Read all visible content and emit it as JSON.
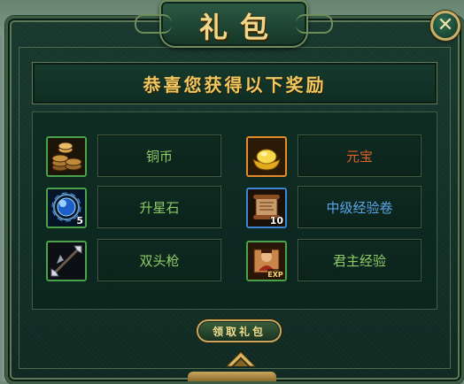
{
  "dialog": {
    "title": "礼包",
    "close_label": "✕",
    "header": "恭喜您获得以下奖励",
    "claim_button": "领取礼包"
  },
  "rewards": [
    {
      "name": "铜币",
      "icon": "copper-coins-icon",
      "count": "",
      "quality": "green",
      "text_color": "#8ecb67"
    },
    {
      "name": "元宝",
      "icon": "gold-ingot-icon",
      "count": "",
      "quality": "orange",
      "text_color": "#e0602a"
    },
    {
      "name": "升星石",
      "icon": "star-stone-icon",
      "count": "5",
      "quality": "green",
      "text_color": "#8ecb67"
    },
    {
      "name": "中级经验卷",
      "icon": "experience-scroll-icon",
      "count": "10",
      "quality": "blue",
      "text_color": "#5ba4e8"
    },
    {
      "name": "双头枪",
      "icon": "double-spear-icon",
      "count": "",
      "quality": "green",
      "text_color": "#8ecb67"
    },
    {
      "name": "君主经验",
      "icon": "lord-exp-icon",
      "count": "",
      "quality": "green",
      "text_color": "#8ecb67"
    }
  ],
  "colors": {
    "title_gold": "#f1d78a",
    "header_gold": "#f0c860",
    "quality_green": "#4aa24a",
    "quality_orange": "#e48b2a",
    "quality_blue": "#3d86d6"
  }
}
